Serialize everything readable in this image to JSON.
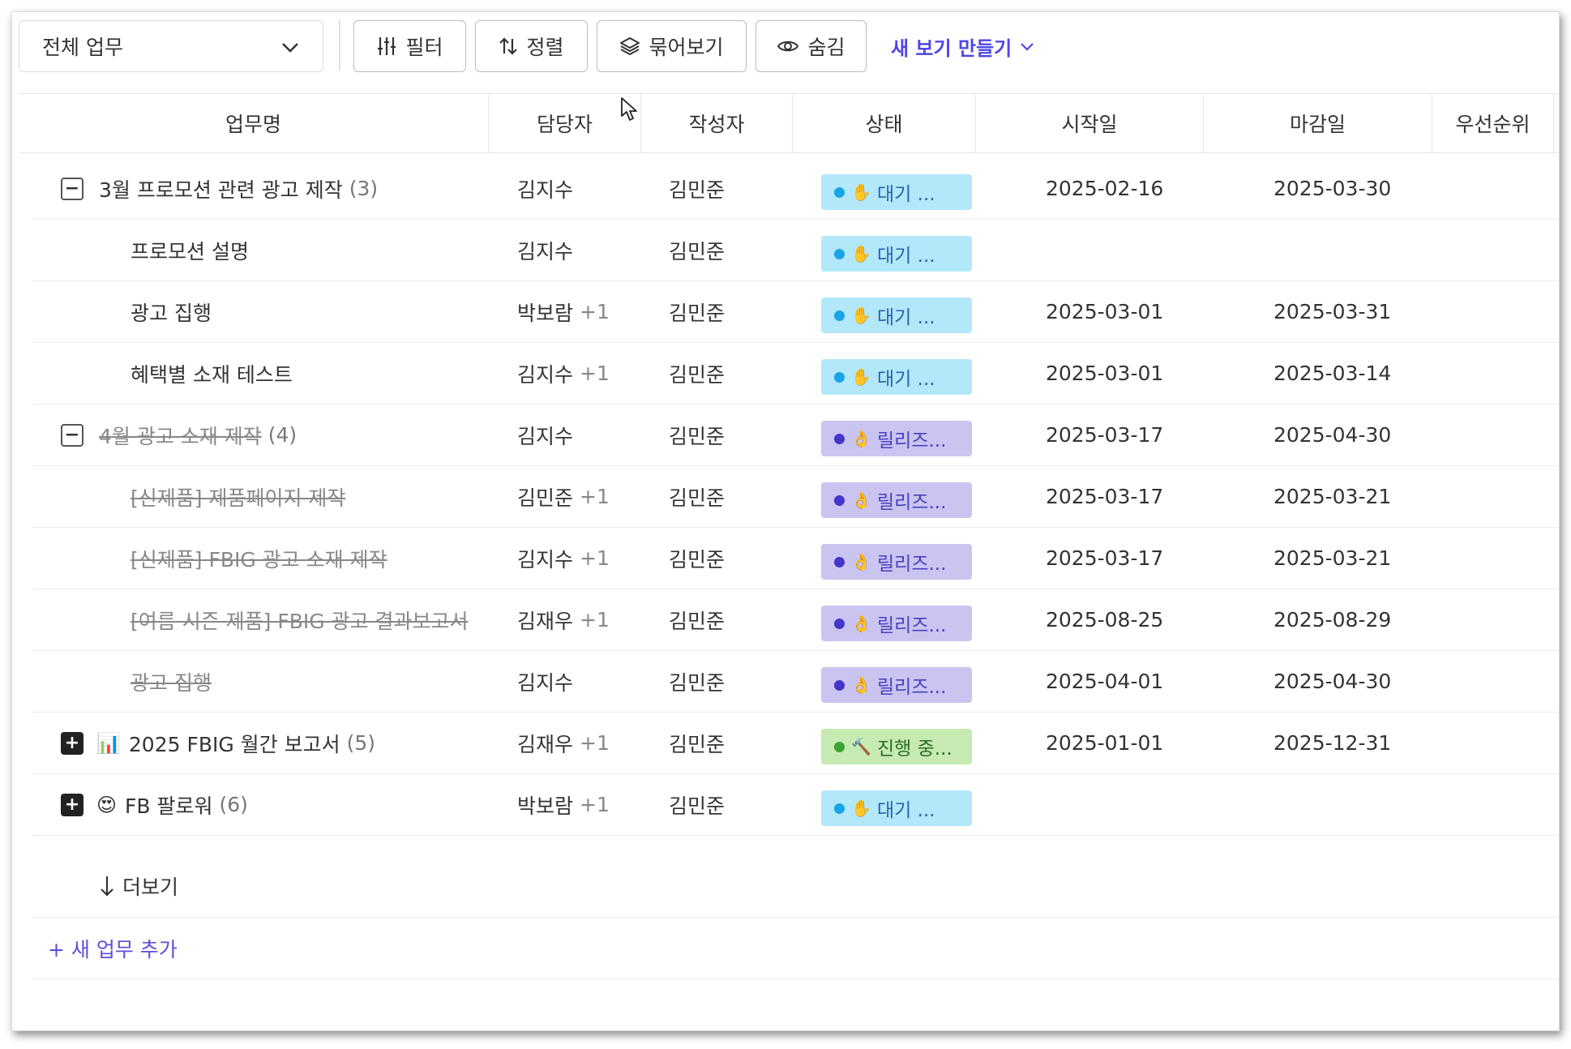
{
  "toolbar": {
    "view_select": "전체 업무",
    "filter_label": "필터",
    "sort_label": "정렬",
    "group_label": "묶어보기",
    "hide_label": "숨김",
    "new_view_label": "새 보기 만들기"
  },
  "columns": [
    "업무명",
    "담당자",
    "작성자",
    "상태",
    "시작일",
    "마감일",
    "우선순위"
  ],
  "rows": [
    {
      "name": "3월 프로모션 관련 광고 제작",
      "count": "(3)",
      "assignee": "김지수",
      "extra": "",
      "author": "김민준",
      "status_emoji": "✋",
      "status": "대기 ...",
      "start": "2025-02-16",
      "due": "2025-03-30"
    },
    {
      "name": "프로모션 설명",
      "count": "",
      "assignee": "김지수",
      "extra": "",
      "author": "김민준",
      "status_emoji": "✋",
      "status": "대기 ...",
      "start": "",
      "due": ""
    },
    {
      "name": "광고 집행",
      "count": "",
      "assignee": "박보람",
      "extra": "+1",
      "author": "김민준",
      "status_emoji": "✋",
      "status": "대기 ...",
      "start": "2025-03-01",
      "due": "2025-03-31"
    },
    {
      "name": "혜택별 소재 테스트",
      "count": "",
      "assignee": "김지수",
      "extra": "+1",
      "author": "김민준",
      "status_emoji": "✋",
      "status": "대기 ...",
      "start": "2025-03-01",
      "due": "2025-03-14"
    },
    {
      "name": "4월 광고 소재 제작",
      "count": "(4)",
      "assignee": "김지수",
      "extra": "",
      "author": "김민준",
      "status_emoji": "👌",
      "status": "릴리즈...",
      "start": "2025-03-17",
      "due": "2025-04-30"
    },
    {
      "name": "[신제품] 제품페이지 제작",
      "count": "",
      "assignee": "김민준",
      "extra": "+1",
      "author": "김민준",
      "status_emoji": "👌",
      "status": "릴리즈...",
      "start": "2025-03-17",
      "due": "2025-03-21"
    },
    {
      "name": "[신제품] FBIG 광고 소재 제작",
      "count": "",
      "assignee": "김지수",
      "extra": "+1",
      "author": "김민준",
      "status_emoji": "👌",
      "status": "릴리즈...",
      "start": "2025-03-17",
      "due": "2025-03-21"
    },
    {
      "name": "[여름 시즌 제품] FBIG 광고 결과보고서",
      "count": "",
      "assignee": "김재우",
      "extra": "+1",
      "author": "김민준",
      "status_emoji": "👌",
      "status": "릴리즈...",
      "start": "2025-08-25",
      "due": "2025-08-29"
    },
    {
      "name": "광고 집행",
      "count": "",
      "assignee": "김지수",
      "extra": "",
      "author": "김민준",
      "status_emoji": "👌",
      "status": "릴리즈...",
      "start": "2025-04-01",
      "due": "2025-04-30"
    },
    {
      "name": "2025 FBIG 월간 보고서",
      "count": "(5)",
      "name_emoji": "📊",
      "assignee": "김재우",
      "extra": "+1",
      "author": "김민준",
      "status_emoji": "🔨",
      "status": "진행 중...",
      "start": "2025-01-01",
      "due": "2025-12-31"
    },
    {
      "name": "FB 팔로워",
      "count": "(6)",
      "name_emoji": "😍",
      "assignee": "박보람",
      "extra": "+1",
      "author": "김민준",
      "status_emoji": "✋",
      "status": "대기 ...",
      "start": "",
      "due": ""
    }
  ],
  "more_label": "더보기",
  "add_task_label": "+ 새 업무 추가",
  "colors": {
    "accent": "#4f46e5",
    "wait": "#b3e8fb",
    "release": "#c9c5f0",
    "progress": "#c6eab2"
  }
}
